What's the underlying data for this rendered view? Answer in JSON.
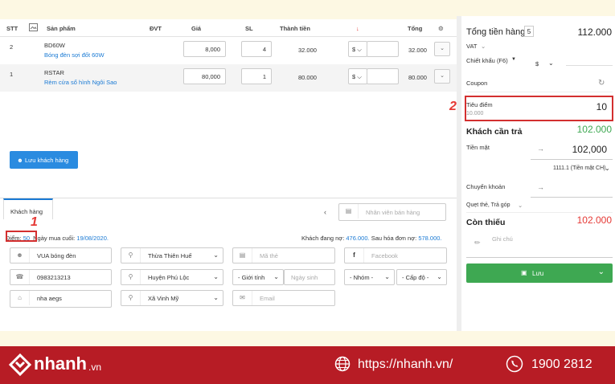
{
  "table": {
    "headers": {
      "stt": "STT",
      "product": "Sản phẩm",
      "unit": "ĐVT",
      "price": "Giá",
      "qty": "SL",
      "amount": "Thành tiền",
      "total": "Tổng"
    },
    "rows": [
      {
        "stt": "2",
        "code": "BD60W",
        "name": "Bóng đèn sợi đốt 60W",
        "price": "8,000",
        "qty": "4",
        "amount": "32.000",
        "disc_unit": "$",
        "total": "32.000"
      },
      {
        "stt": "1",
        "code": "RSTAR",
        "name": "Rèm cửa sổ hình Ngôi Sao",
        "price": "80,000",
        "qty": "1",
        "amount": "80.000",
        "disc_unit": "$",
        "total": "80.000"
      }
    ]
  },
  "customer": {
    "tab_label": "Khách hàng",
    "staff_placeholder": "Nhân viên bán hàng",
    "points_label": "Điểm:",
    "points_value": "50",
    "last_purchase_label": "Ngày mua cuối:",
    "last_purchase_value": "19/08/2020.",
    "debt_label": "Khách đang nợ:",
    "debt_value": "476.000.",
    "after_debt_label": "Sau hóa đơn nợ:",
    "after_debt_value": "578.000.",
    "name": "VUA bóng đèn",
    "phone": "0983213213",
    "address": "nha aegs",
    "province": "Thừa Thiên Huế",
    "district": "Huyện Phú Lộc",
    "ward": "Xã Vinh Mỹ",
    "card_placeholder": "Mã thẻ",
    "gender": "- Giới tính",
    "birthday_placeholder": "Ngày sinh",
    "email_placeholder": "Email",
    "facebook_placeholder": "Facebook",
    "group": "- Nhóm -",
    "level": "- Cấp độ -",
    "save_button": "Lưu khách hàng"
  },
  "summary": {
    "total_goods_label": "Tổng tiền hàng",
    "total_goods_count": "5",
    "total_goods_value": "112.000",
    "vat_label": "VAT",
    "discount_label": "Chiết khấu (F6)",
    "discount_unit": "$",
    "coupon_label": "Coupon",
    "points_use_label": "Tiêu điểm",
    "points_use_sub": "10.000",
    "points_use_value": "10",
    "customer_pay_label": "Khách cần trả",
    "customer_pay_value": "102.000",
    "cash_label": "Tiền mặt",
    "cash_value": "102,000",
    "cash_account": "1111.1 (Tiền mặt CH)",
    "transfer_label": "Chuyển khoản",
    "card_label": "Quẹt thẻ, Trả góp",
    "remaining_label": "Còn thiếu",
    "remaining_value": "102.000",
    "note_placeholder": "Ghi chú",
    "save_button": "Lưu"
  },
  "annotations": {
    "mark1": "1",
    "mark2": "2"
  },
  "footer": {
    "brand": "nhanh",
    "brand_tld": ".vn",
    "website": "https://nhanh.vn/",
    "phone": "1900 2812"
  },
  "colors": {
    "accent_blue": "#1a7ad4",
    "green_value": "#3ea852",
    "red_value": "#e53935",
    "footer_bg": "#b71c25",
    "highlight": "#d32f2f"
  }
}
